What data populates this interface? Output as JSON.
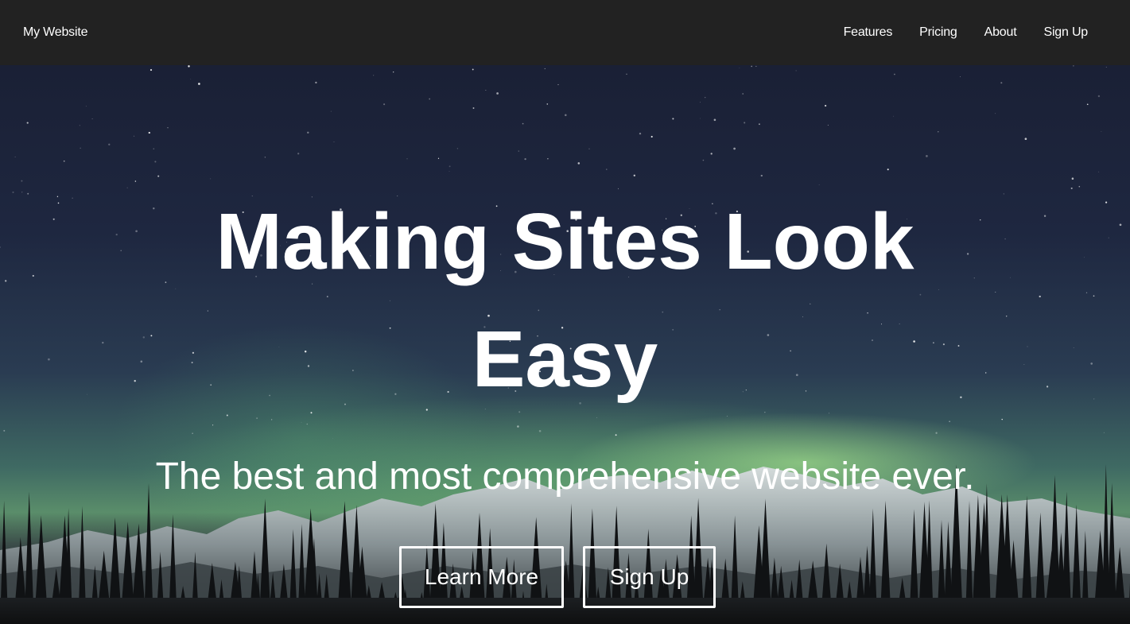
{
  "nav": {
    "brand": "My Website",
    "links": [
      "Features",
      "Pricing",
      "About",
      "Sign Up"
    ]
  },
  "hero": {
    "title": "Making Sites Look Easy",
    "subtitle": "The best and most comprehensive website ever.",
    "buttons": {
      "learn_more": "Learn More",
      "sign_up": "Sign Up"
    }
  },
  "colors": {
    "navbar": "#222222",
    "text": "#ffffff",
    "sky_top": "#1a2035",
    "aurora": "#9ee08a"
  }
}
